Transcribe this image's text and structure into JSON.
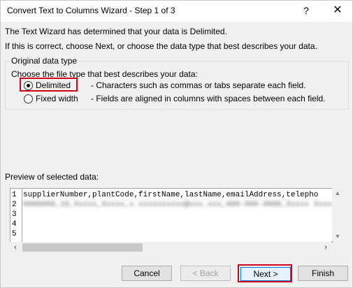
{
  "window": {
    "title": "Convert Text to Columns Wizard - Step 1 of 3",
    "help_glyph": "?",
    "close_glyph": "✕"
  },
  "intro": {
    "line1": "The Text Wizard has determined that your data is Delimited.",
    "line2": "If this is correct, choose Next, or choose the data type that best describes your data."
  },
  "data_type_group": {
    "legend": "Original data type",
    "prompt": "Choose the file type that best describes your data:",
    "options": [
      {
        "label": "Delimited",
        "description": "- Characters such as commas or tabs separate each field.",
        "selected": true
      },
      {
        "label": "Fixed width",
        "description": "- Fields are aligned in columns with spaces between each field.",
        "selected": false
      }
    ]
  },
  "preview": {
    "label": "Preview of selected data:",
    "row_numbers": [
      "1",
      "2",
      "3",
      "4",
      "5"
    ],
    "lines": [
      "supplierNumber,plantCode,firstName,lastName,emailAddress,telepho",
      "0000000,10,Xxxxx,Xxxxx,x.xxxxxxxxxx@xxx.xxx,000-000-0000,Xxxxx Xxxx,00,0"
    ]
  },
  "buttons": {
    "cancel": "Cancel",
    "back": "< Back",
    "next": "Next >",
    "finish": "Finish"
  },
  "colors": {
    "highlight": "#d0021b",
    "default_button_border": "#0078d7"
  }
}
